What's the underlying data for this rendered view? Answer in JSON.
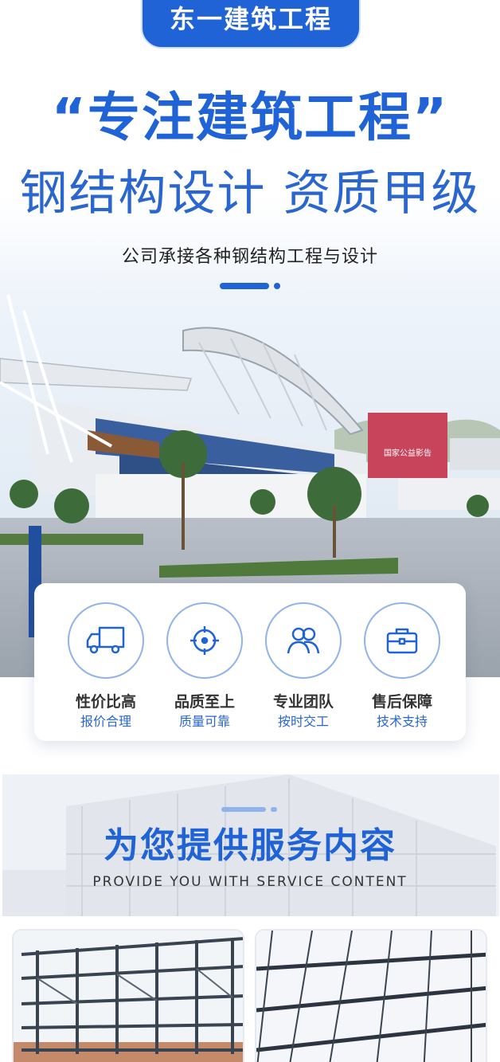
{
  "brand": {
    "name": "东一建筑工程"
  },
  "hero": {
    "headline": "“专注建筑工程”",
    "subheadline": "钢结构设计 资质甲级",
    "tagline": "公司承接各种钢结构工程与设计",
    "billboard_text": "国家公益影告"
  },
  "features": [
    {
      "title": "性价比高",
      "subtitle": "报价合理",
      "icon": "truck-icon"
    },
    {
      "title": "品质至上",
      "subtitle": "质量可靠",
      "icon": "target-icon"
    },
    {
      "title": "专业团队",
      "subtitle": "按时交工",
      "icon": "team-icon"
    },
    {
      "title": "售后保障",
      "subtitle": "技术支持",
      "icon": "briefcase-icon"
    }
  ],
  "services": {
    "title": "为您提供服务内容",
    "subtitle": "PROVIDE YOU WITH SERVICE CONTENT"
  },
  "colors": {
    "primary": "#1f63d6",
    "accent_light": "#8fb3ea",
    "text_dark": "#333333"
  }
}
